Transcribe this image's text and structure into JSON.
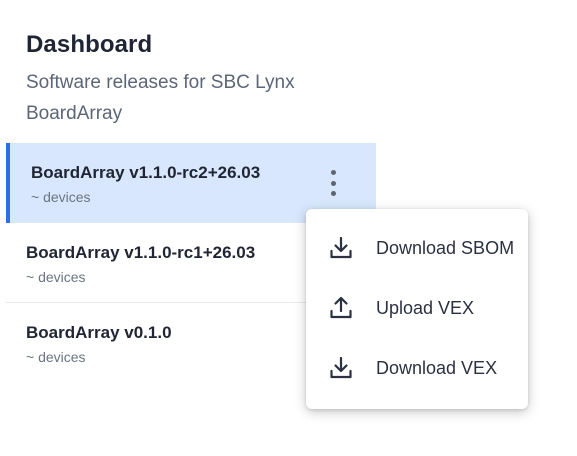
{
  "header": {
    "title": "Dashboard",
    "subtitle_line1": "Software releases for SBC Lynx",
    "subtitle_line2": "BoardArray"
  },
  "releases": [
    {
      "name": "BoardArray v1.1.0-rc2+26.03",
      "meta": "~ devices",
      "selected": true
    },
    {
      "name": "BoardArray v1.1.0-rc1+26.03",
      "meta": "~ devices",
      "selected": false
    },
    {
      "name": "BoardArray v0.1.0",
      "meta": "~ devices",
      "selected": false
    }
  ],
  "context_menu": {
    "items": [
      {
        "label": "Download SBOM",
        "icon": "download-icon"
      },
      {
        "label": "Upload VEX",
        "icon": "upload-icon"
      },
      {
        "label": "Download VEX",
        "icon": "download-icon"
      }
    ]
  },
  "colors": {
    "selected_background": "#d8e7fd",
    "selected_accent": "#2f6ee6",
    "text_primary": "#1f2533",
    "text_secondary": "#5b6676"
  }
}
